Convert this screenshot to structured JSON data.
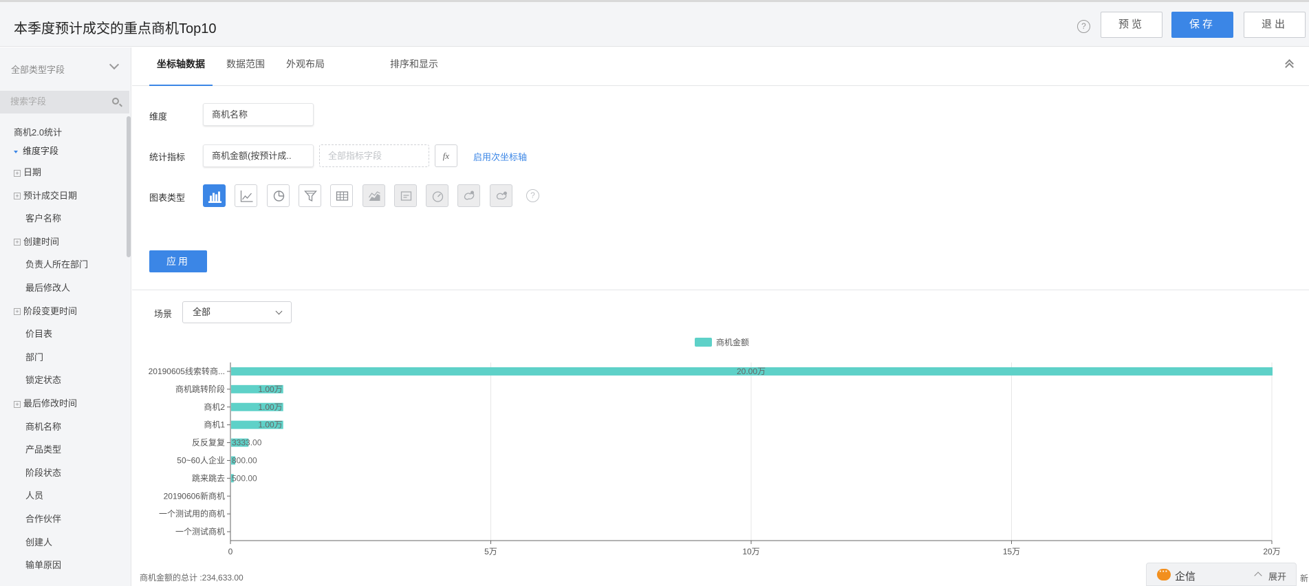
{
  "header": {
    "title": "本季度预计成交的重点商机Top10",
    "help_label": "?",
    "preview_label": "预览",
    "save_label": "保存",
    "exit_label": "退出"
  },
  "sidebar": {
    "type_filter": "全部类型字段",
    "search_placeholder": "搜索字段",
    "root_label": "商机2.0统计",
    "group_label": "维度字段",
    "fields": [
      {
        "label": "日期",
        "expandable": true
      },
      {
        "label": "预计成交日期",
        "expandable": true
      },
      {
        "label": "客户名称",
        "expandable": false
      },
      {
        "label": "创建时间",
        "expandable": true
      },
      {
        "label": "负责人所在部门",
        "expandable": false
      },
      {
        "label": "最后修改人",
        "expandable": false
      },
      {
        "label": "阶段变更时间",
        "expandable": true
      },
      {
        "label": "价目表",
        "expandable": false
      },
      {
        "label": "部门",
        "expandable": false
      },
      {
        "label": "锁定状态",
        "expandable": false
      },
      {
        "label": "最后修改时间",
        "expandable": true
      },
      {
        "label": "商机名称",
        "expandable": false
      },
      {
        "label": "产品类型",
        "expandable": false
      },
      {
        "label": "阶段状态",
        "expandable": false
      },
      {
        "label": "人员",
        "expandable": false
      },
      {
        "label": "合作伙伴",
        "expandable": false
      },
      {
        "label": "创建人",
        "expandable": false
      },
      {
        "label": "输单原因",
        "expandable": false
      }
    ]
  },
  "tabs": [
    {
      "label": "坐标轴数据",
      "active": true
    },
    {
      "label": "数据范围",
      "active": false
    },
    {
      "label": "外观布局",
      "active": false
    },
    {
      "label": "排序和显示",
      "active": false
    }
  ],
  "config": {
    "dimension_label": "维度",
    "dimension_value": "商机名称",
    "metric_label": "统计指标",
    "metric_value": "商机金额(按预计成..",
    "metric_placeholder": "全部指标字段",
    "fx_label": "fx",
    "secondary_axis_link": "启用次坐标轴",
    "chart_type_label": "图表类型",
    "chart_type_icons": [
      {
        "name": "bar-chart-icon",
        "state": "active"
      },
      {
        "name": "line-chart-icon",
        "state": "normal"
      },
      {
        "name": "pie-chart-icon",
        "state": "normal"
      },
      {
        "name": "funnel-chart-icon",
        "state": "normal"
      },
      {
        "name": "table-chart-icon",
        "state": "normal"
      },
      {
        "name": "area-chart-icon",
        "state": "disabled"
      },
      {
        "name": "card-chart-icon",
        "state": "disabled"
      },
      {
        "name": "gauge-chart-icon",
        "state": "disabled"
      },
      {
        "name": "map-chart-icon",
        "state": "disabled"
      },
      {
        "name": "map-alt-chart-icon",
        "state": "disabled"
      }
    ],
    "apply_label": "应用"
  },
  "scene": {
    "label": "场景",
    "value": "全部"
  },
  "chart_data": {
    "type": "bar",
    "orientation": "horizontal",
    "categories": [
      "20190605线索转商...",
      "商机跳转阶段",
      "商机2",
      "商机1",
      "反反复复",
      "50~60人企业",
      "跳来跳去",
      "20190606新商机",
      "一个测试用的商机",
      "一个测试商机"
    ],
    "series": [
      {
        "name": "商机金额",
        "color": "#5ed1c8",
        "values": [
          200000,
          10000,
          10000,
          10000,
          3333,
          800,
          500,
          0,
          0,
          0
        ],
        "data_labels": [
          "20.00万",
          "1.00万",
          "1.00万",
          "1.00万",
          "3333.00",
          "800.00",
          "500.00",
          "",
          "",
          ""
        ]
      }
    ],
    "xlim": [
      0,
      200000
    ],
    "x_ticks": [
      0,
      50000,
      100000,
      150000,
      200000
    ],
    "x_tick_labels": [
      "0",
      "5万",
      "10万",
      "15万",
      "20万"
    ],
    "legend_position": "top",
    "grid": true
  },
  "footer": {
    "total_label": "商机金额的总计 :234,633.00"
  },
  "chat": {
    "name": "企信",
    "expand_label": "展开"
  },
  "edge_text": "新"
}
